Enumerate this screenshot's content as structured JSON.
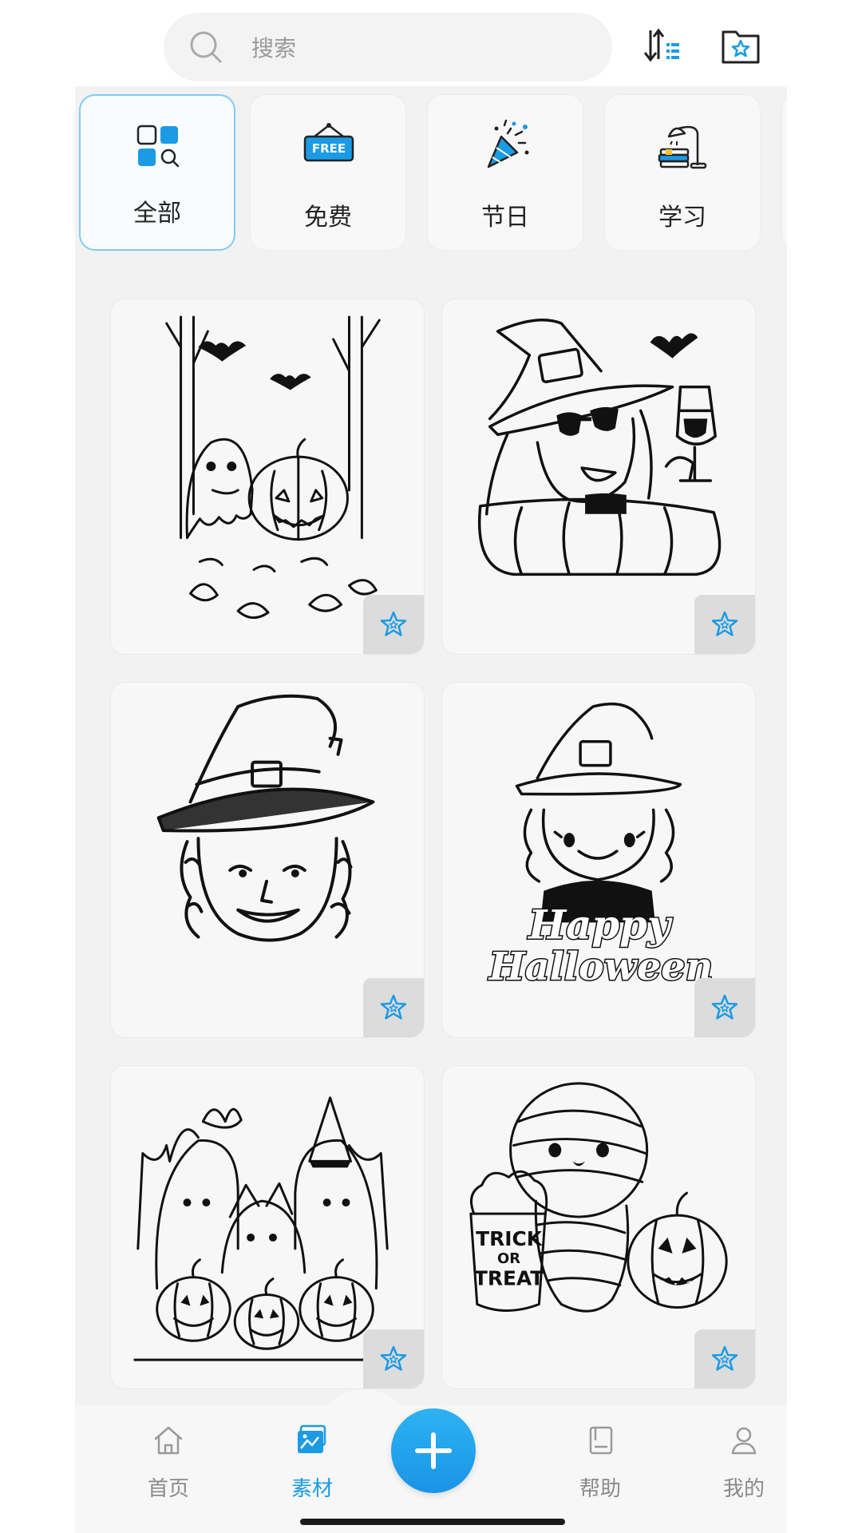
{
  "search": {
    "placeholder": "搜索",
    "icon": "search-icon"
  },
  "toolbar": {
    "sort_icon": "sort-icon",
    "favorites_icon": "favorites-folder-icon"
  },
  "categories": [
    {
      "label": "全部",
      "icon": "all-grid-icon",
      "selected": true
    },
    {
      "label": "免费",
      "icon": "free-tag-icon",
      "selected": false
    },
    {
      "label": "节日",
      "icon": "party-popper-icon",
      "selected": false
    },
    {
      "label": "学习",
      "icon": "desk-lamp-books-icon",
      "selected": false
    }
  ],
  "cards": [
    {
      "subject": "ghost-pumpkin-forest-art",
      "fav_icon": "star-icon",
      "favorited": false
    },
    {
      "subject": "witch-sunglasses-wine-art",
      "fav_icon": "star-icon",
      "favorited": false
    },
    {
      "subject": "witch-portrait-art",
      "fav_icon": "star-icon",
      "favorited": false
    },
    {
      "subject": "witch-girl-happy-halloween-art",
      "fav_icon": "star-icon",
      "favorited": false,
      "text": [
        "Happy",
        "Halloween"
      ]
    },
    {
      "subject": "ghosts-pumpkins-group-art",
      "fav_icon": "star-icon",
      "favorited": false
    },
    {
      "subject": "mummy-sloth-trick-or-treat-art",
      "fav_icon": "star-icon",
      "favorited": false,
      "text": [
        "TRICK",
        "OR",
        "TREAT"
      ]
    }
  ],
  "nav": {
    "items": [
      {
        "label": "首页",
        "icon": "home-icon",
        "active": false
      },
      {
        "label": "素材",
        "icon": "gallery-icon",
        "active": true
      },
      {
        "label": "帮助",
        "icon": "help-book-icon",
        "active": false
      },
      {
        "label": "我的",
        "icon": "profile-icon",
        "active": false
      }
    ],
    "create_icon": "plus-icon"
  },
  "colors": {
    "accent": "#1a9be4",
    "selected_border": "#7fcdf2",
    "content_bg": "#f2f2f2"
  }
}
